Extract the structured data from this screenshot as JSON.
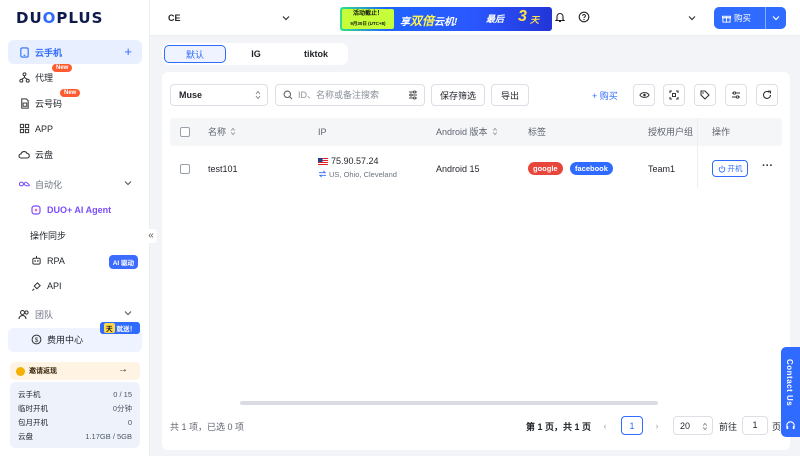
{
  "app": {
    "logo": "DUOPLUS"
  },
  "sidebar": {
    "cloud_phone": "云手机",
    "proxy": "代理",
    "proxy_badge": "New",
    "cloud_number": "云号码",
    "cloud_number_badge": "New",
    "app": "APP",
    "cloud_disk": "云盘",
    "automation": "自动化",
    "ai_agent": "DUO+ AI Agent",
    "op_sync": "操作同步",
    "rpa": "RPA",
    "rpa_badge": "AI 驱动",
    "api": "API",
    "team": "团队",
    "billing": "费用中心",
    "billing_badge_key": "天",
    "billing_badge": "就送！",
    "invite": "邀请返现",
    "invite_arrow": "→",
    "stats": [
      {
        "label": "云手机",
        "value": "0 / 15"
      },
      {
        "label": "临时开机",
        "value": "0分钟"
      },
      {
        "label": "包月开机",
        "value": "0"
      },
      {
        "label": "云盘",
        "value": "1.17GB / 5GB"
      }
    ],
    "collapse": "«"
  },
  "topbar": {
    "group": "CE",
    "banner": {
      "tag_line1": "活动截止！",
      "tag_line2": "9月30日 (UTC+8)",
      "main_prefix": "享",
      "main_big": "双倍",
      "main_suffix": "云机!",
      "last": "最后",
      "three": "3",
      "tian": "天"
    },
    "buy_label": "购买"
  },
  "tabs": [
    {
      "label": "默认",
      "active": true
    },
    {
      "label": "IG",
      "active": false
    },
    {
      "label": "tiktok",
      "active": false
    }
  ],
  "toolbar": {
    "app_select": "Muse",
    "search_placeholder": "ID、名称或备注搜索",
    "save_filter": "保存筛选",
    "export": "导出",
    "buy": "+ 购买"
  },
  "table": {
    "columns": [
      "名称",
      "IP",
      "Android 版本",
      "标签",
      "授权用户组",
      "操作"
    ],
    "rows": [
      {
        "name": "test101",
        "ip": "75.90.57.24",
        "location": "US, Ohio, Cleveland",
        "android": "Android 15",
        "tags": [
          "google",
          "facebook"
        ],
        "group": "Team1",
        "power_btn": "开机",
        "more": "···"
      }
    ]
  },
  "footer": {
    "total": "共 1 项，已选 0 项",
    "page_info": "第 1 页，共 1 页",
    "prev": "‹",
    "current_page": "1",
    "next": "›",
    "page_size": "20",
    "goto": "前往",
    "goto_value": "1",
    "page_suffix": "页"
  },
  "contact": "Contact Us",
  "colors": {
    "primary": "#2f6bff",
    "google": "#e8463b",
    "new_badge": "#ff5a30"
  }
}
